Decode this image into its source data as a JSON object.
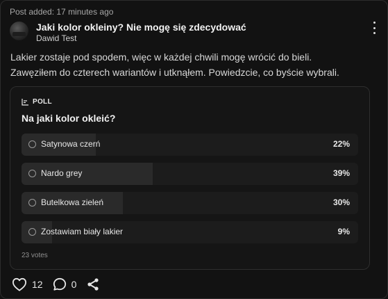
{
  "post": {
    "added_label": "Post added: 17 minutes ago",
    "title": "Jaki kolor okleiny? Nie mogę się zdecydować",
    "author": "Dawid Test",
    "body_line1": "Lakier zostaje pod spodem, więc w każdej chwili mogę wrócić do bieli.",
    "body_line2": "Zawęziłem do czterech wariantów i utknąłem. Powiedzcie, co byście wybrali."
  },
  "poll": {
    "label": "POLL",
    "question": "Na jaki kolor okleić?",
    "options": [
      {
        "label": "Satynowa czerń",
        "percent": "22%",
        "share": 0.22
      },
      {
        "label": "Nardo grey",
        "percent": "39%",
        "share": 0.39
      },
      {
        "label": "Butelkowa zieleń",
        "percent": "30%",
        "share": 0.3
      },
      {
        "label": "Zostawiam biały lakier",
        "percent": "9%",
        "share": 0.09
      }
    ],
    "votes": "23 votes"
  },
  "actions": {
    "likes": "12",
    "comments": "0"
  },
  "icons": {
    "poll": "poll-icon",
    "like": "heart-icon",
    "comment": "comment-icon",
    "share": "share-icon",
    "menu": "more-vertical-icon"
  }
}
